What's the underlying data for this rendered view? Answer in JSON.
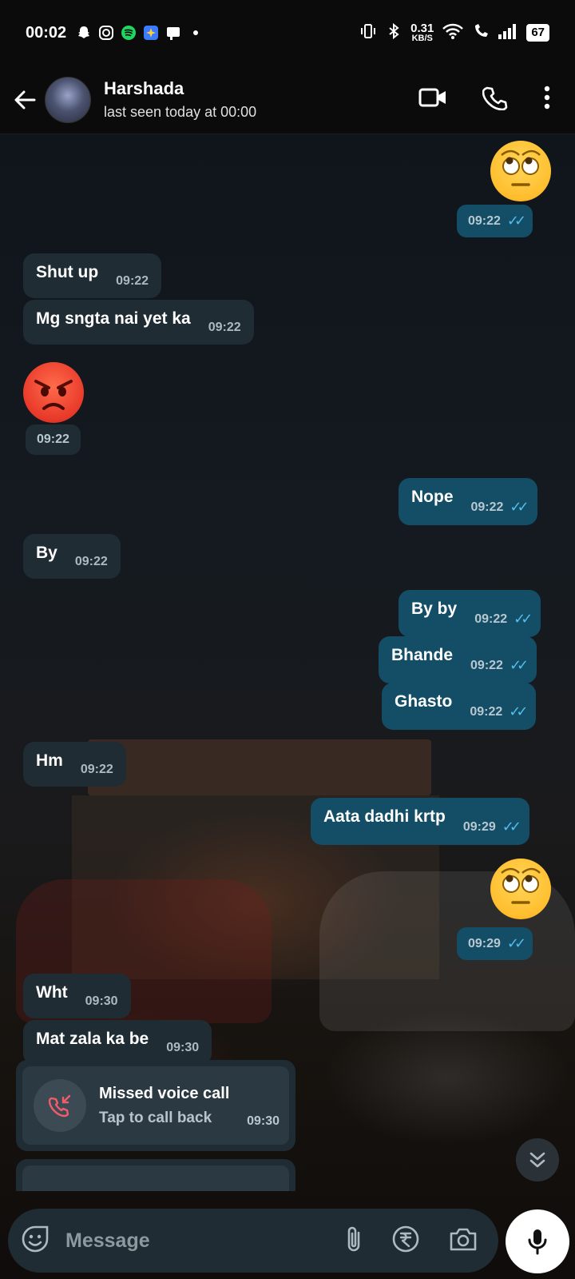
{
  "status_bar": {
    "time": "00:02",
    "network_speed": "0.31",
    "network_unit": "KB/S",
    "battery": "67",
    "icons": [
      "snapchat-icon",
      "instagram-icon",
      "spotify-icon",
      "app-icon",
      "gallery-icon",
      "dot-icon",
      "vibrate-icon",
      "bluetooth-icon",
      "wifi-icon",
      "wifi-call-icon",
      "signal-icon",
      "battery-icon"
    ]
  },
  "header": {
    "contact_name": "Harshada",
    "last_seen": "last seen today at 00:00",
    "actions": [
      "video-call-icon",
      "voice-call-icon",
      "more-options-icon"
    ]
  },
  "messages": {
    "m1": {
      "time": "09:22"
    },
    "m2": {
      "text": "Shut up",
      "time": "09:22"
    },
    "m3": {
      "text": "Mg sngta nai yet ka",
      "time": "09:22"
    },
    "m4": {
      "time": "09:22"
    },
    "m5": {
      "text": "Nope",
      "time": "09:22"
    },
    "m6": {
      "text": "By",
      "time": "09:22"
    },
    "m7": {
      "text": "By by",
      "time": "09:22"
    },
    "m8": {
      "text": "Bhande",
      "time": "09:22"
    },
    "m9": {
      "text": "Ghasto",
      "time": "09:22"
    },
    "m10": {
      "text": "Hm",
      "time": "09:22"
    },
    "m11": {
      "text": "Aata dadhi krtp",
      "time": "09:29"
    },
    "m12": {
      "time": "09:29"
    },
    "m13": {
      "text": "Wht",
      "time": "09:30"
    },
    "m14": {
      "text": "Mat zala ka be",
      "time": "09:30"
    }
  },
  "missed_call": {
    "title": "Missed voice call",
    "subtitle": "Tap to call back",
    "time": "09:30"
  },
  "composer": {
    "placeholder": "Message",
    "icons": [
      "emoji-icon",
      "attach-icon",
      "rupee-payment-icon",
      "camera-icon",
      "mic-icon"
    ]
  },
  "colors": {
    "incoming_bubble": "#1f2c33",
    "outgoing_bubble": "#134d66",
    "read_ticks": "#53bdeb",
    "missed_call_red": "#f15c6d"
  }
}
